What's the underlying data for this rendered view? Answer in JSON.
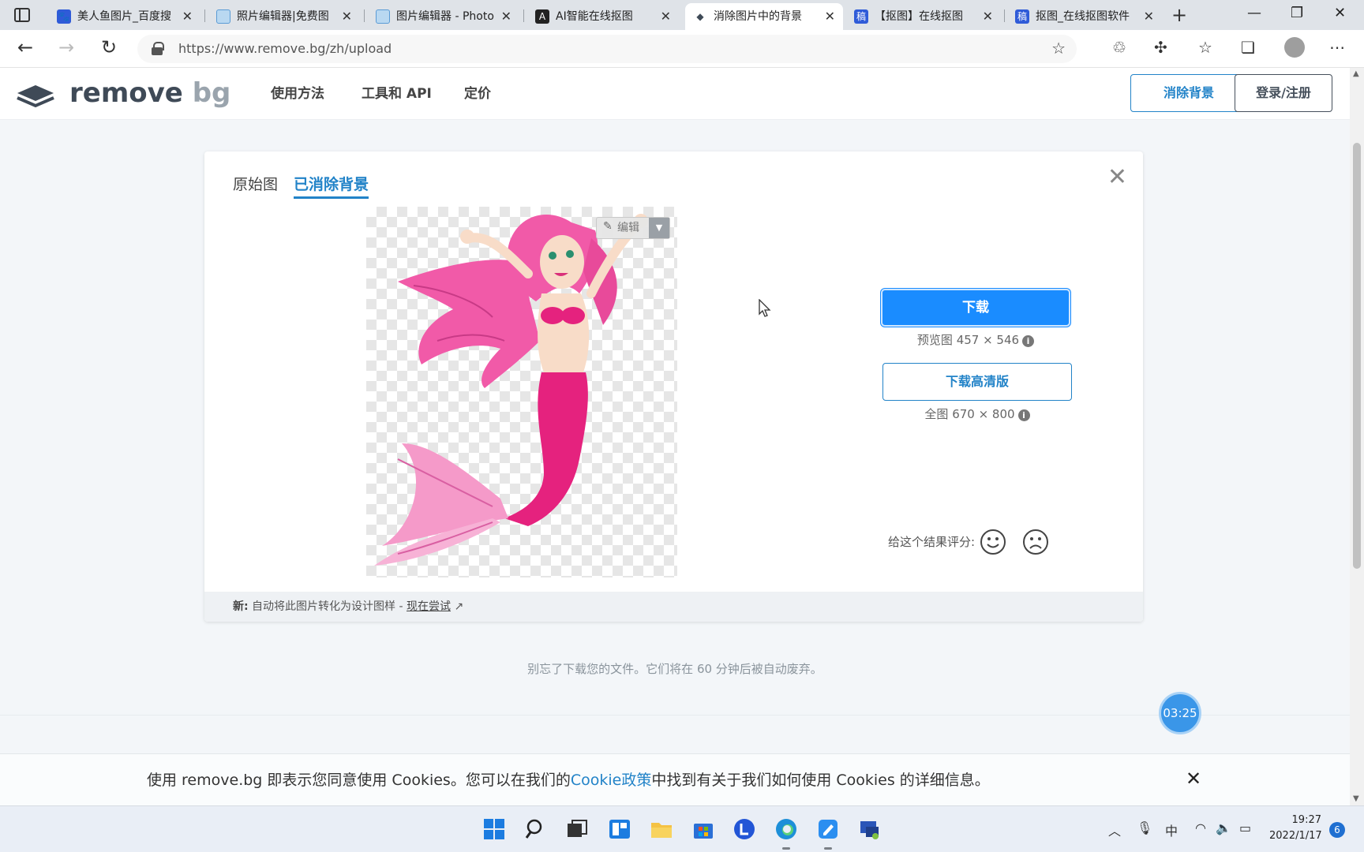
{
  "browser": {
    "tabs": [
      {
        "label": "美人鱼图片_百度搜",
        "favicon": "baidu-paw-icon",
        "active": false
      },
      {
        "label": "照片编辑器|免费图",
        "favicon": "image-editor-icon",
        "active": false
      },
      {
        "label": "图片编辑器 - Photo",
        "favicon": "image-editor-icon",
        "active": false
      },
      {
        "label": "AI智能在线抠图",
        "favicon": "ai-logo-icon",
        "active": false
      },
      {
        "label": "消除图片中的背景",
        "favicon": "removebg-icon",
        "active": true
      },
      {
        "label": "【抠图】在线抠图",
        "favicon": "gao-icon",
        "active": false
      },
      {
        "label": "抠图_在线抠图软件",
        "favicon": "gao-icon",
        "active": false
      }
    ],
    "url": "https://www.remove.bg/zh/upload"
  },
  "header": {
    "logo_main": "remove",
    "logo_accent": "bg",
    "nav": [
      "使用方法",
      "工具和 API",
      "定价"
    ],
    "primary_button": "消除背景",
    "login_button": "登录/注册"
  },
  "result": {
    "tab_original": "原始图",
    "tab_removed": "已消除背景",
    "edit_label": "编辑",
    "download_label": "下载",
    "preview_size": "预览图 457 × 546",
    "download_hd_label": "下载高清版",
    "full_size": "全图 670 × 800",
    "rate_label": "给这个结果评分:",
    "footer_new": "新:",
    "footer_text": " 自动将此图片转化为设计图样 - ",
    "footer_link": "现在尝试"
  },
  "notice": "别忘了下载您的文件。它们将在 60 分钟后被自动废弃。",
  "timer": "03:25",
  "cookie": {
    "before": "使用 remove.bg 即表示您同意使用 Cookies。您可以在我们的",
    "link": "Cookie政策",
    "after": "中找到有关于我们如何使用 Cookies 的详细信息。"
  },
  "taskbar": {
    "time": "19:27",
    "date": "2022/1/17",
    "ime": "中",
    "notifications": "6"
  },
  "colors": {
    "accent": "#2283c8",
    "download": "#1a8cff",
    "mermaid_hair": "#f15aa8",
    "mermaid_tail": "#e5227e"
  }
}
